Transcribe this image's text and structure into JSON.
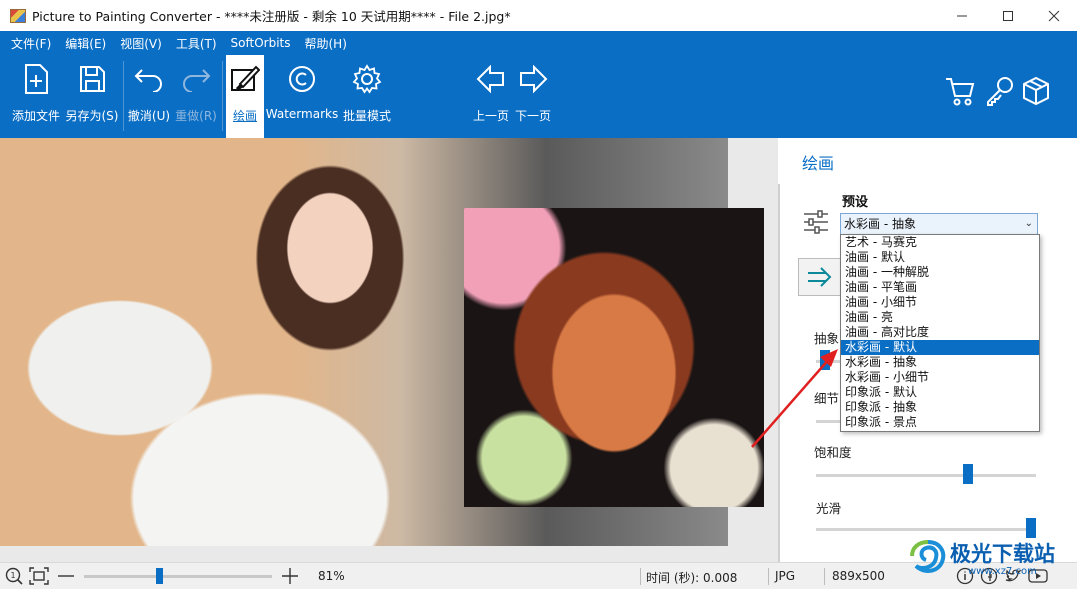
{
  "window": {
    "title": "Picture to Painting Converter - ****未注册版 - 剩余 10 天试用期**** - File 2.jpg*"
  },
  "menu": [
    "文件(F)",
    "编辑(E)",
    "视图(V)",
    "工具(T)",
    "SoftOrbits",
    "帮助(H)"
  ],
  "toolbar": {
    "add_file": "添加文件",
    "save_as": "另存为(S)",
    "undo": "撤消(U)",
    "redo": "重做(R)",
    "paint": "绘画",
    "watermarks": "Watermarks",
    "batch": "批量模式",
    "prev": "上一页",
    "next": "下一页"
  },
  "panel": {
    "title": "绘画",
    "preset_label": "预设",
    "preset_value": "水彩画 - 抽象",
    "params": {
      "abstract": "抽象",
      "detail": "细节",
      "saturation": "饱和度",
      "smooth": "光滑"
    },
    "levels": {
      "abstract": 0.02,
      "saturation": 0.7,
      "smooth": 1.0
    }
  },
  "dropdown": {
    "items": [
      "艺术 - 马赛克",
      "油画 - 默认",
      "油画 - 一种解脱",
      "油画 - 平笔画",
      "油画 - 小细节",
      "油画 - 亮",
      "油画 - 高对比度",
      "水彩画 - 默认",
      "水彩画 - 抽象",
      "水彩画 - 小细节",
      "印象派 - 默认",
      "印象派 - 抽象",
      "印象派 - 景点"
    ],
    "selected_index": 7
  },
  "status": {
    "zoom": "81%",
    "zoom_level": 0.4,
    "time": "时间 (秒): 0.008",
    "format": "JPG",
    "size": "889x500"
  },
  "watermark": {
    "text": "极光下载站",
    "sub": "www.xz7.com"
  },
  "colors": {
    "accent": "#0b6ec5",
    "arrow": "#e02020"
  }
}
